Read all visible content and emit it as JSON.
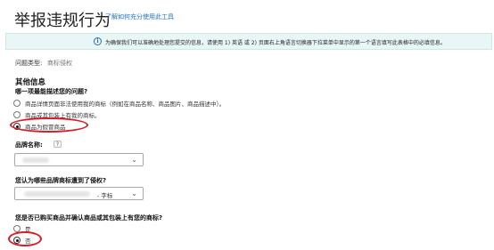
{
  "page": {
    "title": "举报违规行为",
    "help_link": "了解如何充分使用此工具"
  },
  "notice": {
    "icon": "info-icon",
    "text": "为确保我们可以准确地处理您提交的信息，请使用 1) 英语 或 2) 页面右上角语言切换器下拉菜单中显示的第一个语言填写此表格中的必填信息。"
  },
  "issue": {
    "label": "问题类型:",
    "value": "商标侵权"
  },
  "other_info": {
    "section_title": "其他信息",
    "question": "哪一项最能描述您的问题?",
    "options": [
      {
        "label": "商品详情页面非法使用我的商标（例如在商品名称、商品图片、商品描述中）。",
        "checked": false
      },
      {
        "label": "商品或其包装上有我的商标。",
        "checked": false
      },
      {
        "label": "商品为假冒商品",
        "checked": true
      }
    ]
  },
  "brand": {
    "label": "品牌名称:",
    "help": "?",
    "select_value": ""
  },
  "trademark": {
    "label": "您认为哪些品牌商标遭到了侵权?",
    "select_suffix": "- 字标"
  },
  "purchase": {
    "label": "您是否已购买商品并确认商品或其包装上有您的商标?",
    "options": [
      {
        "label": "是",
        "checked": false
      },
      {
        "label": "否",
        "checked": true
      }
    ]
  },
  "colors": {
    "accent_link": "#1a73c8",
    "notice_bg": "#e8f6f6",
    "annotation_red": "#d41f2a"
  }
}
